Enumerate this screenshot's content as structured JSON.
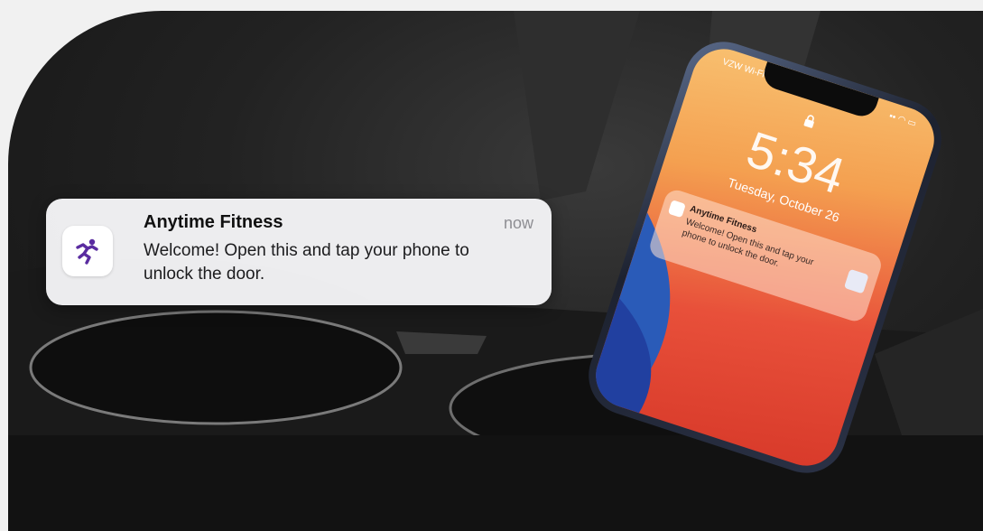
{
  "notification": {
    "app_name": "Anytime Fitness",
    "time": "now",
    "message": "Welcome! Open this and tap your phone to unlock the door.",
    "icon": "anytime-fitness-runner-icon"
  },
  "phone_lock_screen": {
    "carrier": "VZW Wi-Fi",
    "time": "5:34",
    "date": "Tuesday, October 26",
    "notification": {
      "app_name": "Anytime Fitness",
      "message": "Welcome! Open this and tap your phone to unlock the door."
    }
  },
  "colors": {
    "brand_purple": "#5a2ca0",
    "wallpaper_orange": "#f4a050",
    "wallpaper_red": "#e8503a"
  }
}
